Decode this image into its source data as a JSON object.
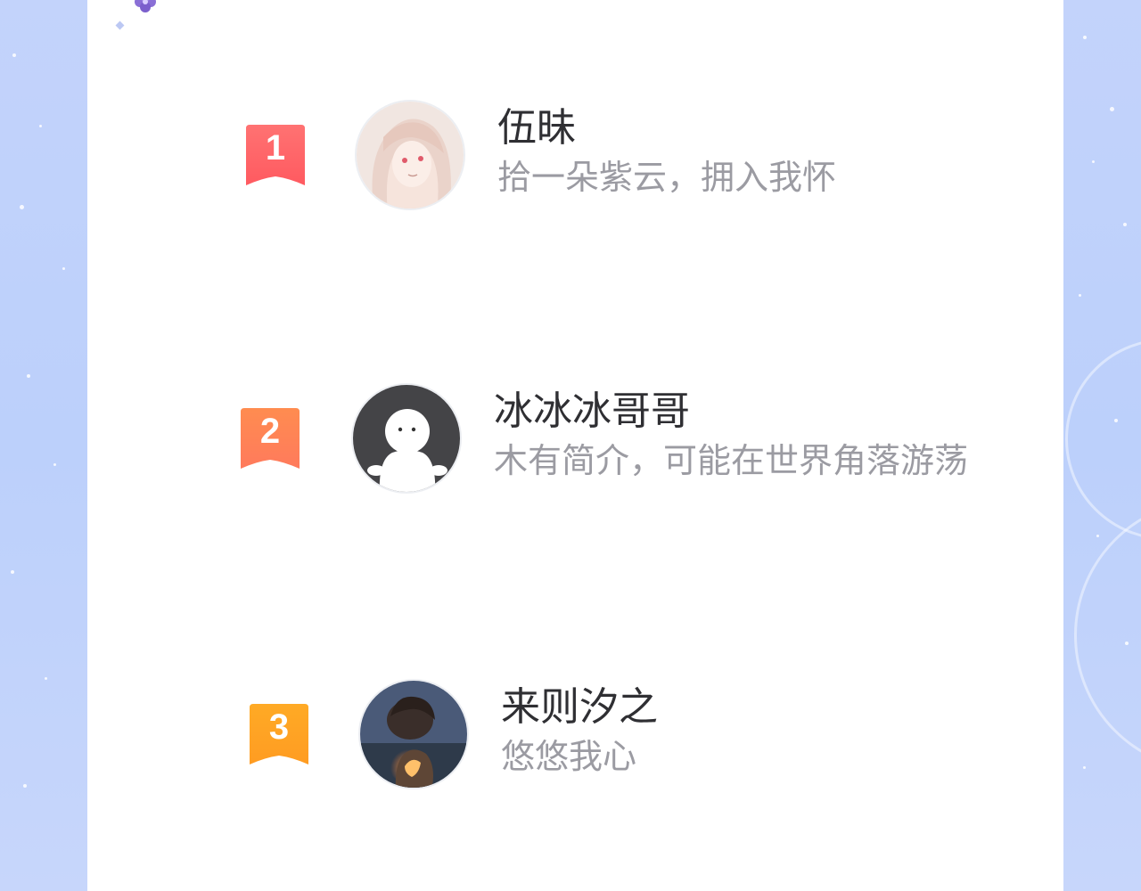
{
  "ranking": [
    {
      "rank": "1",
      "name": "伍昧",
      "bio": "拾一朵紫云，拥入我怀",
      "badge_color_top": "#ff6d6d",
      "badge_color_bottom": "#ff5a5f",
      "avatar": "anime-girl-avatar"
    },
    {
      "rank": "2",
      "name": "冰冰冰哥哥",
      "bio": "木有简介，可能在世界角落游荡",
      "badge_color_top": "#ff8a50",
      "badge_color_bottom": "#ff7b59",
      "avatar": "default-person-avatar"
    },
    {
      "rank": "3",
      "name": "来则汐之",
      "bio": "悠悠我心",
      "badge_color_top": "#ffad2a",
      "badge_color_bottom": "#ff9a1f",
      "avatar": "painted-portrait-avatar"
    }
  ],
  "colors": {
    "background": "#c3d3fb",
    "panel": "#ffffff",
    "name_text": "#2f2f33",
    "bio_text": "#9b9ba2",
    "flower": "#8a6fd6"
  }
}
